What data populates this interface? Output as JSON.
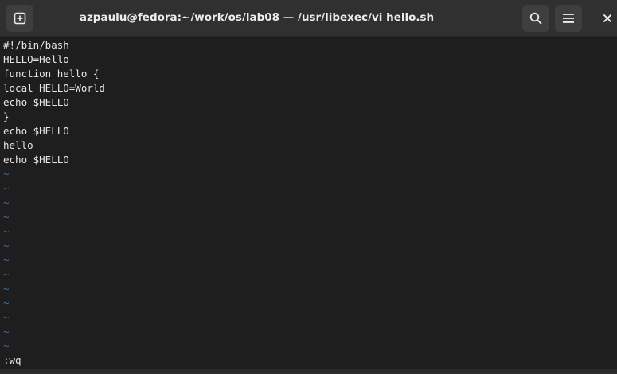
{
  "window": {
    "title": "azpaulu@fedora:~/work/os/lab08 — /usr/libexec/vi hello.sh"
  },
  "icons": {
    "new_tab": "new-tab-icon",
    "search": "search-icon",
    "menu": "hamburger-menu-icon",
    "close": "close-icon"
  },
  "colors": {
    "background": "#1e1e1e",
    "titlebar": "#303030",
    "text": "#e6e6e6",
    "tilde": "#3a6da8"
  },
  "editor": {
    "lines": [
      "#!/bin/bash",
      "HELLO=Hello",
      "function hello {",
      "local HELLO=World",
      "echo $HELLO",
      "}",
      "echo $HELLO",
      "hello",
      "echo $HELLO"
    ],
    "empty_marker": "~",
    "command_line": ":wq"
  }
}
